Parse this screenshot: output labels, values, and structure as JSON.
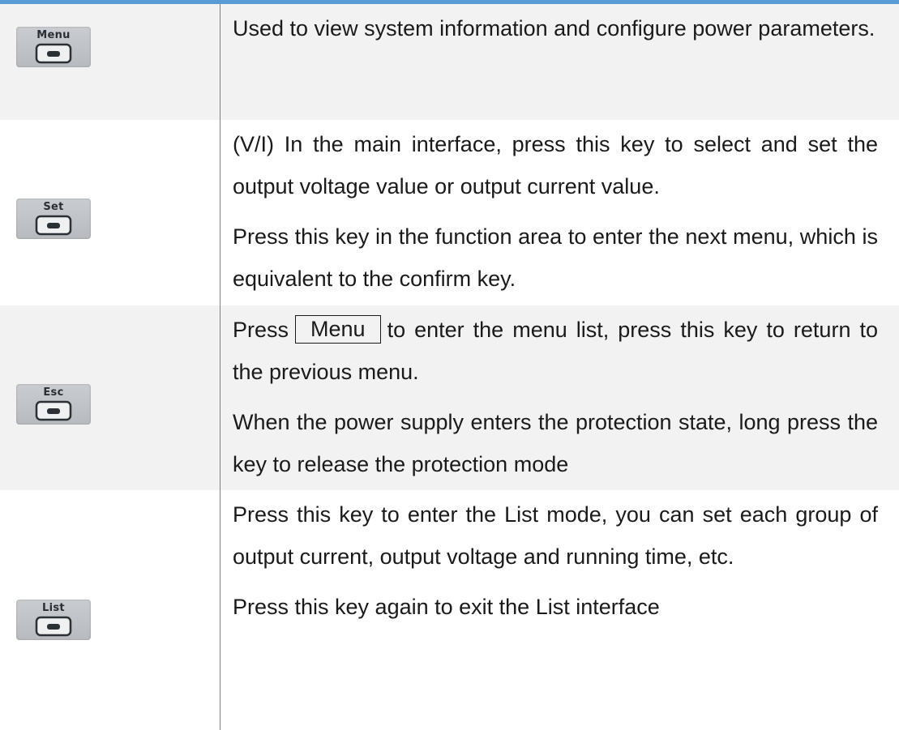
{
  "rows": [
    {
      "key_label": "Menu",
      "paragraphs": [
        "Used to view system information and configure power parameters."
      ]
    },
    {
      "key_label": "Set",
      "paragraphs": [
        "(V/I) In the main interface, press this key to select and set the output voltage value or output current value.",
        "Press this key in the function area to enter the next menu, which is equivalent to the confirm key."
      ]
    },
    {
      "key_label": "Esc",
      "p1_before": "Press",
      "p1_key": "Menu",
      "p1_after": "to enter the menu list, press this key to return to the previous menu.",
      "paragraphs": [
        "When the power supply enters the protection state, long press the key to release the protection mode"
      ]
    },
    {
      "key_label": "List",
      "paragraphs": [
        "Press this key to enter the List mode, you can set each group of output current, output voltage and running time, etc.",
        "Press this key again to exit the List interface"
      ]
    }
  ],
  "colors": {
    "top_rule": "#5b9bd5",
    "shaded_row": "#f2f2f2",
    "divider": "#7f7f7f"
  },
  "icons": {
    "key_button": "rounded-rect-button-icon"
  }
}
